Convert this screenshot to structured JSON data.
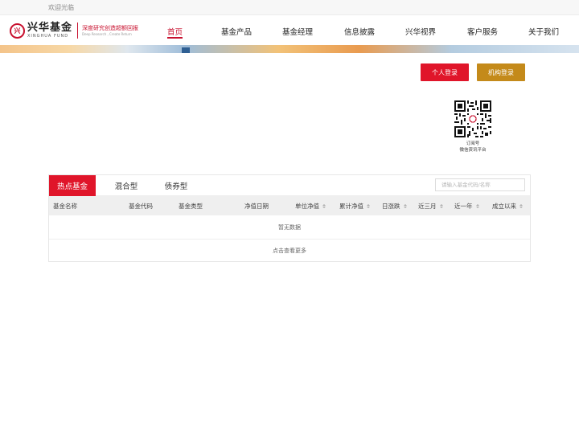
{
  "topbar": {
    "welcome": "欢迎光临"
  },
  "logo": {
    "cn": "兴华基金",
    "en": "XINGHUA FUND",
    "mark": "兴",
    "slogan_cn": "深度研究创造超额回报",
    "slogan_en": "Deep Research , Create Return"
  },
  "nav": [
    {
      "label": "首页",
      "active": true
    },
    {
      "label": "基金产品"
    },
    {
      "label": "基金经理"
    },
    {
      "label": "信息披露"
    },
    {
      "label": "兴华视界"
    },
    {
      "label": "客户服务"
    },
    {
      "label": "关于我们"
    }
  ],
  "login": {
    "personal": "个人登录",
    "org": "机构登录"
  },
  "qr": {
    "line1": "订阅号",
    "line2": "微信资讯平台"
  },
  "fund_tabs": [
    "热点基金",
    "混合型",
    "债券型"
  ],
  "search": {
    "placeholder": "请输入基金代码/名称"
  },
  "table": {
    "columns": [
      "基金名称",
      "基金代码",
      "基金类型",
      "净值日期",
      "单位净值",
      "累计净值",
      "日涨跌",
      "近三月",
      "近一年",
      "成立以来"
    ],
    "empty_text": "暂无数据",
    "more_text": "点击查看更多"
  },
  "colors": {
    "accent_red": "#e0152a",
    "gold": "#c48a1a"
  }
}
